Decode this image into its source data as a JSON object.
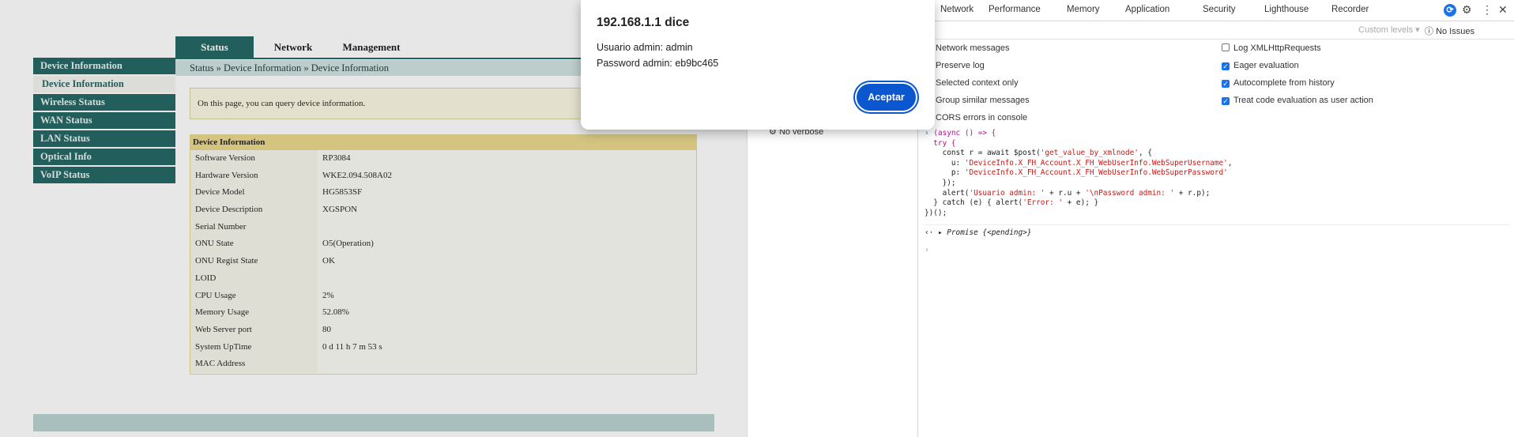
{
  "router": {
    "tabs": [
      "Status",
      "Network",
      "Management"
    ],
    "sidebar": [
      "Device Information",
      "Device Information",
      "Wireless Status",
      "WAN Status",
      "LAN Status",
      "Optical Info",
      "VoIP Status"
    ],
    "breadcrumb": "Status » Device Information » Device Information",
    "notice": "On this page, you can query device information.",
    "table_title": "Device Information",
    "rows": [
      {
        "k": "Software Version",
        "v": "RP3084"
      },
      {
        "k": "Hardware Version",
        "v": "WKE2.094.508A02"
      },
      {
        "k": "Device Model",
        "v": "HG5853SF"
      },
      {
        "k": "Device Description",
        "v": "XGSPON"
      },
      {
        "k": "Serial Number",
        "v": ""
      },
      {
        "k": "ONU State",
        "v": "O5(Operation)"
      },
      {
        "k": "ONU Regist State",
        "v": "OK"
      },
      {
        "k": "LOID",
        "v": ""
      },
      {
        "k": "CPU Usage",
        "v": "2%"
      },
      {
        "k": "Memory Usage",
        "v": "52.08%"
      },
      {
        "k": "Web Server port",
        "v": "80"
      },
      {
        "k": "System UpTime",
        "v": "0 d 11 h 7 m 53 s"
      },
      {
        "k": "MAC Address",
        "v": ""
      }
    ]
  },
  "devtools": {
    "tabs": [
      "Network",
      "Performance",
      "Memory",
      "Application",
      "Security",
      "Lighthouse",
      "Recorder"
    ],
    "filter": {
      "levels": "Custom levels ▾",
      "issues": "No Issues"
    },
    "options_left": [
      "Network messages",
      "Preserve log",
      "Selected context only",
      "Group similar messages",
      "CORS errors in console"
    ],
    "options_right": [
      {
        "label": "Log XMLHttpRequests",
        "checked": false
      },
      {
        "label": "Eager evaluation",
        "checked": true
      },
      {
        "label": "Autocomplete from history",
        "checked": true
      },
      {
        "label": "Treat code evaluation as user action",
        "checked": true
      }
    ],
    "verbose": "No verbose",
    "code": {
      "l1": "(async () => {",
      "l2": "  try {",
      "l3a": "    const r = await $post(",
      "l3s": "'get_value_by_xmlnode'",
      "l3b": ", {",
      "l4a": "      u: ",
      "l4s": "'DeviceInfo.X_FH_Account.X_FH_WebUserInfo.WebSuperUsername'",
      "l4b": ",",
      "l5a": "      p: ",
      "l5s": "'DeviceInfo.X_FH_Account.X_FH_WebUserInfo.WebSuperPassword'",
      "l6": "    });",
      "l7a": "    alert(",
      "l7s1": "'Usuario admin: '",
      "l7b": " + r.u + ",
      "l7s2": "'\\nPassword admin: '",
      "l7c": " + r.p);",
      "l8a": "  } catch (e) { alert(",
      "l8s": "'Error: '",
      "l8b": " + e); }",
      "l9": "})();"
    },
    "promise": "Promise {<pending>}"
  },
  "dialog": {
    "title": "192.168.1.1 dice",
    "line1": "Usuario admin: admin",
    "line2": "Password admin: eb9bc465",
    "button": "Aceptar"
  }
}
